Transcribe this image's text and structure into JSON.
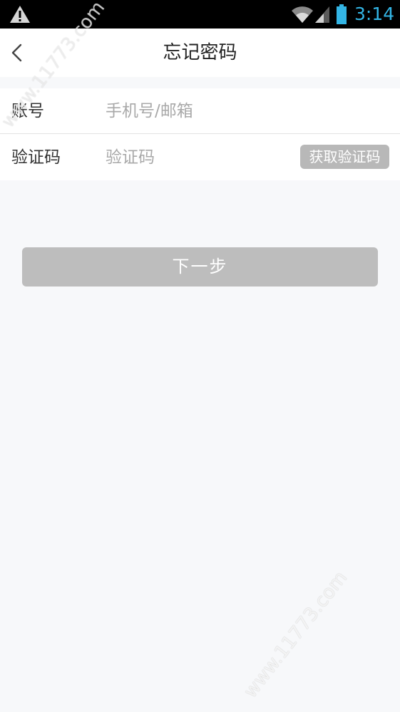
{
  "status_bar": {
    "time": "3:14",
    "icons": [
      "warning-icon",
      "wifi-icon",
      "signal-icon",
      "battery-icon"
    ],
    "clock_color": "#33b5e5"
  },
  "header": {
    "back_icon": "chevron-left-icon",
    "title": "忘记密码"
  },
  "form": {
    "account": {
      "label": "账号",
      "placeholder": "手机号/邮箱",
      "value": ""
    },
    "code": {
      "label": "验证码",
      "placeholder": "验证码",
      "value": "",
      "get_code_label": "获取验证码"
    }
  },
  "next_button": {
    "label": "下一步"
  },
  "watermarks": [
    "www.11773.com",
    "www.11773.com"
  ],
  "colors": {
    "page_background": "#f7f8fa",
    "disabled_button": "#bdbdbd",
    "divider": "#e3e3e3"
  }
}
